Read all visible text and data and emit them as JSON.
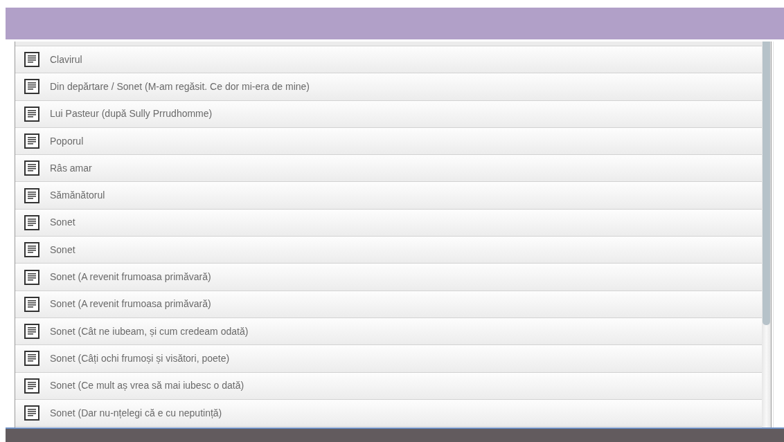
{
  "items": [
    {
      "title": "Clavirul"
    },
    {
      "title": "Din depărtare / Sonet (M-am regăsit. Ce dor mi-era de mine)"
    },
    {
      "title": "Lui Pasteur (după Sully Prrudhomme)"
    },
    {
      "title": "Poporul"
    },
    {
      "title": "Râs amar"
    },
    {
      "title": "Sămănătorul"
    },
    {
      "title": "Sonet"
    },
    {
      "title": "Sonet"
    },
    {
      "title": "Sonet (A revenit frumoasa primăvară)"
    },
    {
      "title": "Sonet (A revenit frumoasa primăvară)"
    },
    {
      "title": "Sonet (Cât ne iubeam, și cum credeam odată)"
    },
    {
      "title": "Sonet (Câți ochi frumoși și visători, poete)"
    },
    {
      "title": "Sonet (Ce mult aș vrea să mai iubesc o dată)"
    },
    {
      "title": "Sonet (Dar nu-nțelegi că e cu neputință)"
    }
  ]
}
